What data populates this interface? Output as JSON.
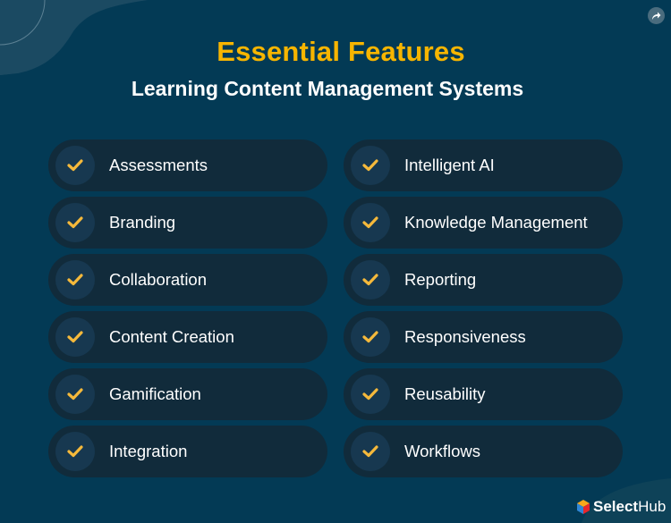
{
  "header": {
    "title": "Essential Features",
    "subtitle": "Learning Content Management Systems"
  },
  "features": {
    "left": [
      {
        "label": "Assessments"
      },
      {
        "label": "Branding"
      },
      {
        "label": "Collaboration"
      },
      {
        "label": "Content Creation"
      },
      {
        "label": "Gamification"
      },
      {
        "label": "Integration"
      }
    ],
    "right": [
      {
        "label": "Intelligent AI"
      },
      {
        "label": "Knowledge Management"
      },
      {
        "label": "Reporting"
      },
      {
        "label": "Responsiveness"
      },
      {
        "label": "Reusability"
      },
      {
        "label": "Workflows"
      }
    ]
  },
  "icons": {
    "item": "check-icon",
    "share": "share-icon"
  },
  "brand": {
    "name_bold": "Select",
    "name_regular": "Hub"
  },
  "colors": {
    "background": "#033a55",
    "accent": "#f7b500",
    "pill": "#112b3b",
    "check_circle": "#173850",
    "check": "#f5b93b"
  }
}
